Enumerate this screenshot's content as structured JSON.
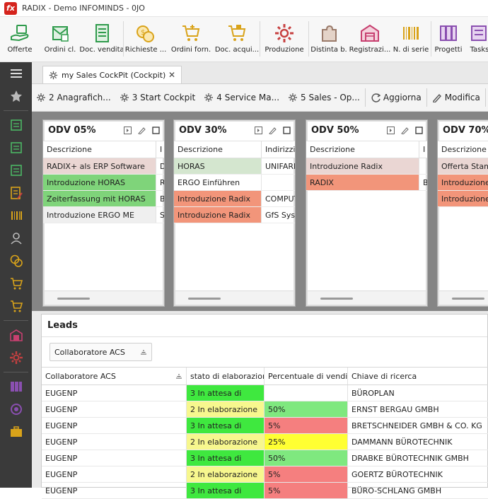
{
  "window": {
    "title": "RADIX - Demo INFOMINDS - 0JO",
    "logo_text": "fx"
  },
  "ribbon": [
    {
      "label": "Offerte",
      "icon": "offer-hand-icon",
      "color": "#2f9b4c"
    },
    {
      "label": "Ordini cl.",
      "icon": "customer-order-icon",
      "color": "#2f9b4c"
    },
    {
      "label": "Doc. vendita",
      "icon": "sales-document-icon",
      "color": "#2f9b4c"
    },
    {
      "label": "Richieste ...",
      "icon": "coins-icon",
      "color": "#d9a31a"
    },
    {
      "label": "Ordini forn.",
      "icon": "cart-plus-icon",
      "color": "#d9a31a"
    },
    {
      "label": "Doc. acqui...",
      "icon": "cart-icon",
      "color": "#d9a31a"
    },
    {
      "label": "Produzione",
      "icon": "gear-icon",
      "color": "#c74040"
    },
    {
      "label": "Distinta b.",
      "icon": "puzzle-icon",
      "color": "#9a7a6a"
    },
    {
      "label": "Registrazi...",
      "icon": "warehouse-icon",
      "color": "#c74070"
    },
    {
      "label": "N. di serie",
      "icon": "barcode-icon",
      "color": "#d9a31a"
    },
    {
      "label": "Progetti",
      "icon": "binders-icon",
      "color": "#8a4fb0"
    },
    {
      "label": "Tasks",
      "icon": "tasks-icon",
      "color": "#8a4fb0"
    }
  ],
  "sidebar_icons": [
    "menu-icon",
    "star-icon",
    "offer-icon",
    "customer-order-icon",
    "sales-document-icon",
    "document-edit-icon",
    "barcode-icon",
    "person-icon",
    "coins-icon",
    "cart-plus-icon",
    "cart-icon",
    "warehouse-icon",
    "gear-icon",
    "binders-icon",
    "target-icon",
    "briefcase-icon"
  ],
  "tab": {
    "label": "my Sales CockPit (Cockpit)",
    "close": "✕"
  },
  "toolbar": [
    {
      "label": "2 Anagrafich...",
      "icon": "gear-icon"
    },
    {
      "label": "3 Start Cockpit",
      "icon": "gear-icon"
    },
    {
      "label": "4 Service Ma...",
      "icon": "gear-icon"
    },
    {
      "label": "5 Sales - Op...",
      "icon": "gear-icon"
    },
    {
      "label": "Aggiorna",
      "icon": "refresh-icon"
    },
    {
      "label": "Modifica",
      "icon": "pencil-icon"
    },
    {
      "label": "Organizza",
      "icon": "pencil-icon"
    }
  ],
  "cards": [
    {
      "title": "ODV 05%",
      "columns": [
        "Descrizione",
        "I"
      ],
      "rows": [
        {
          "desc": "RADIX+ als ERP Software",
          "c2": "D",
          "color": "#ead6d3"
        },
        {
          "desc": "Introduzione HORAS",
          "c2": "R",
          "color": "#7fd47a"
        },
        {
          "desc": "Zeiterfassung mit HORAS",
          "c2": "B",
          "color": "#7fd47a"
        },
        {
          "desc": "Introduzione ERGO ME",
          "c2": "S",
          "color": "#efefef"
        }
      ]
    },
    {
      "title": "ODV 30%",
      "columns": [
        "Descrizione",
        "Indirizzi-"
      ],
      "rows": [
        {
          "desc": "HORAS",
          "c2": "UNIFARI",
          "color": "#d4e6cf"
        },
        {
          "desc": "ERGO Einführen",
          "c2": "",
          "color": "#ffffff"
        },
        {
          "desc": "Introduzione Radix",
          "c2": "COMPUT",
          "color": "#f2957a"
        },
        {
          "desc": "Introduzione Radix",
          "c2": "GfS Syst",
          "color": "#f2957a"
        }
      ]
    },
    {
      "title": "ODV 50%",
      "columns": [
        "Descrizione",
        "I"
      ],
      "rows": [
        {
          "desc": "Introduzione Radix",
          "c2": "",
          "color": "#ead6d3"
        },
        {
          "desc": "RADIX",
          "c2": "B",
          "color": "#f2957a"
        }
      ]
    },
    {
      "title": "ODV 70%",
      "columns": [
        "Descrizione",
        ""
      ],
      "rows": [
        {
          "desc": "Offerta Stamp",
          "c2": "",
          "color": "#ead6d3"
        },
        {
          "desc": "Introduzione R",
          "c2": "",
          "color": "#f2957a"
        },
        {
          "desc": "Introduzione R",
          "c2": "",
          "color": "#f2957a"
        }
      ]
    }
  ],
  "leads": {
    "title": "Leads",
    "group_chip": "Collaboratore ACS",
    "columns": [
      "Collaboratore ACS",
      "stato di elaborazione",
      "Percentuale di vendita",
      "Chiave di ricerca"
    ],
    "rows": [
      {
        "user": "EUGENP",
        "stato": "3 In attesa di",
        "stato_color": "#3fe83f",
        "pct": "",
        "pct_color": "#ffffff",
        "key": "BÜROPLAN"
      },
      {
        "user": "EUGENP",
        "stato": "2 In elaborazione",
        "stato_color": "#f7f78e",
        "pct": "50%",
        "pct_color": "#7fe87f",
        "key": "ERNST BERGAU GMBH"
      },
      {
        "user": "EUGENP",
        "stato": "3 In attesa di",
        "stato_color": "#3fe83f",
        "pct": "5%",
        "pct_color": "#f57f7f",
        "key": "BRETSCHNEIDER GMBH & CO. KG"
      },
      {
        "user": "EUGENP",
        "stato": "2 In elaborazione",
        "stato_color": "#f7f78e",
        "pct": "25%",
        "pct_color": "#ffff33",
        "key": "DAMMANN BÜROTECHNIK"
      },
      {
        "user": "EUGENP",
        "stato": "3 In attesa di",
        "stato_color": "#3fe83f",
        "pct": "50%",
        "pct_color": "#7fe87f",
        "key": "DRABKE BÜROTECHNIK GMBH"
      },
      {
        "user": "EUGENP",
        "stato": "2 In elaborazione",
        "stato_color": "#f7f78e",
        "pct": "5%",
        "pct_color": "#f57f7f",
        "key": "GOERTZ BÜROTECHNIK"
      },
      {
        "user": "EUGENP",
        "stato": "3 In attesa di",
        "stato_color": "#3fe83f",
        "pct": "5%",
        "pct_color": "#f57f7f",
        "key": "BÜRO-SCHLANG GMBH"
      }
    ]
  }
}
